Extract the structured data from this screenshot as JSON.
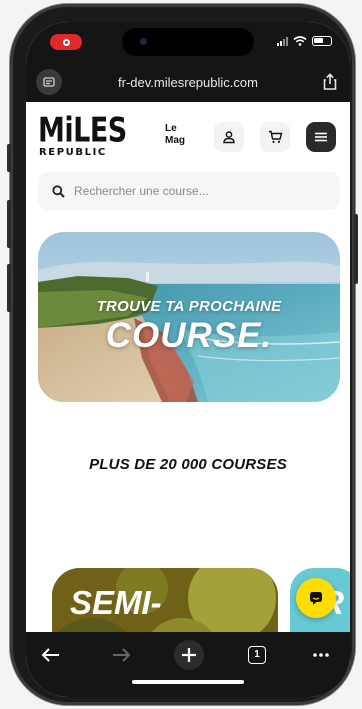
{
  "browser": {
    "url": "fr-dev.milesrepublic.com"
  },
  "header": {
    "logo_top": "MiLES",
    "logo_bottom": "REPUBLIC",
    "lemag_line1": "Le",
    "lemag_line2": "Mag"
  },
  "search": {
    "placeholder": "Rechercher une course..."
  },
  "hero": {
    "line1": "TROUVE TA PROCHAINE",
    "line2": "COURSE."
  },
  "section": {
    "count_title": "PLUS DE 20 000 COURSES"
  },
  "cards": [
    {
      "label": "SEMI-"
    },
    {
      "label": "TR"
    }
  ],
  "icons": {
    "reader": "reader-mode-icon",
    "share": "share-icon",
    "user": "user-icon",
    "cart": "cart-icon",
    "menu": "menu-icon",
    "search": "search-icon",
    "chat": "chat-icon",
    "back": "back-arrow-icon",
    "forward": "forward-arrow-icon",
    "new_tab": "plus-icon",
    "tabs": "tabs-icon",
    "more": "more-icon"
  },
  "toolbar": {
    "tab_count": "1"
  },
  "colors": {
    "accent_yellow": "#ffdd00",
    "record_red": "#e02a2a",
    "card_teal": "#66c9d3",
    "dark": "#151515"
  }
}
